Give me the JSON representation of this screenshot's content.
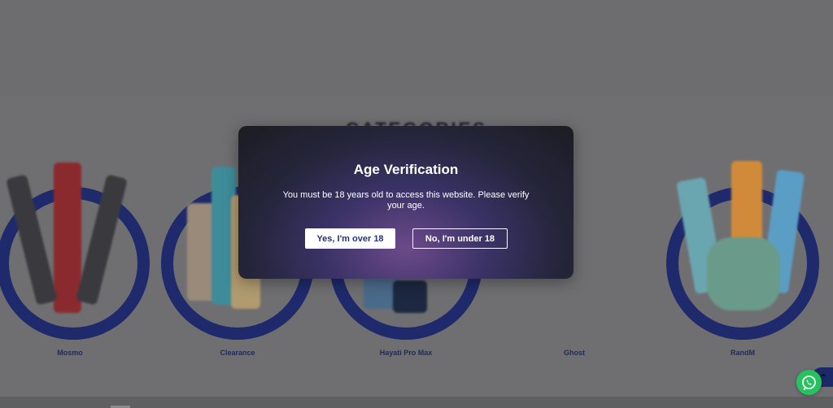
{
  "categories": {
    "heading": "CATEGORIES",
    "items": [
      {
        "label": "Mosmo"
      },
      {
        "label": "Clearance"
      },
      {
        "label": "Hayati Pro Max"
      },
      {
        "label": "Ghost"
      },
      {
        "label": "RandM"
      }
    ]
  },
  "modal": {
    "title": "Age Verification",
    "message": "You must be 18 years old to access this website. Please verify your age.",
    "confirm_label": "Yes, I'm over 18",
    "deny_label": "No, I'm under 18"
  },
  "widgets": {
    "scroll_top_icon": "chevron-up-icon",
    "whatsapp_icon": "whatsapp-icon"
  },
  "colors": {
    "accent": "#1e2a6b",
    "whatsapp": "#25c35d",
    "modal_bg": "#2a2a3e"
  }
}
